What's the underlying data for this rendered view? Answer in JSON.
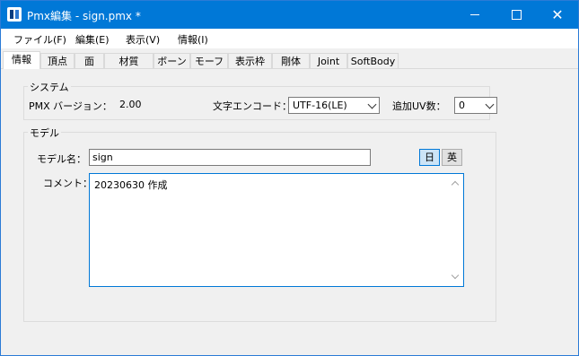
{
  "window": {
    "title": "Pmx編集 - sign.pmx *"
  },
  "menu": [
    "ファイル(F)",
    "編集(E)",
    "表示(V)",
    "情報(I)"
  ],
  "tabs": [
    "情報",
    "頂点",
    "面",
    "材質",
    "ボーン",
    "モーフ",
    "表示枠",
    "剛体",
    "Joint",
    "SoftBody"
  ],
  "active_tab": "情報",
  "system": {
    "title": "システム",
    "version_label": "PMX バージョン：",
    "version_value": "2.00",
    "encode_label": "文字エンコード：",
    "encode_value": "UTF-16(LE)",
    "uv_label": "追加UV数：",
    "uv_value": "0"
  },
  "model": {
    "title": "モデル",
    "name_label": "モデル名：",
    "name_value": "sign",
    "lang_jp": "日",
    "lang_en": "英",
    "comment_label": "コメント：",
    "comment_value": "20230630 作成"
  }
}
